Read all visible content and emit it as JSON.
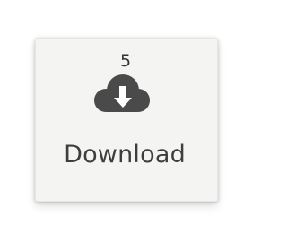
{
  "download": {
    "count": "5",
    "label": "Download",
    "icon": "cloud-download-icon"
  },
  "colors": {
    "tile_background": "#f4f4f2",
    "icon": "#4a4a4a",
    "text": "#3e3e3e"
  }
}
